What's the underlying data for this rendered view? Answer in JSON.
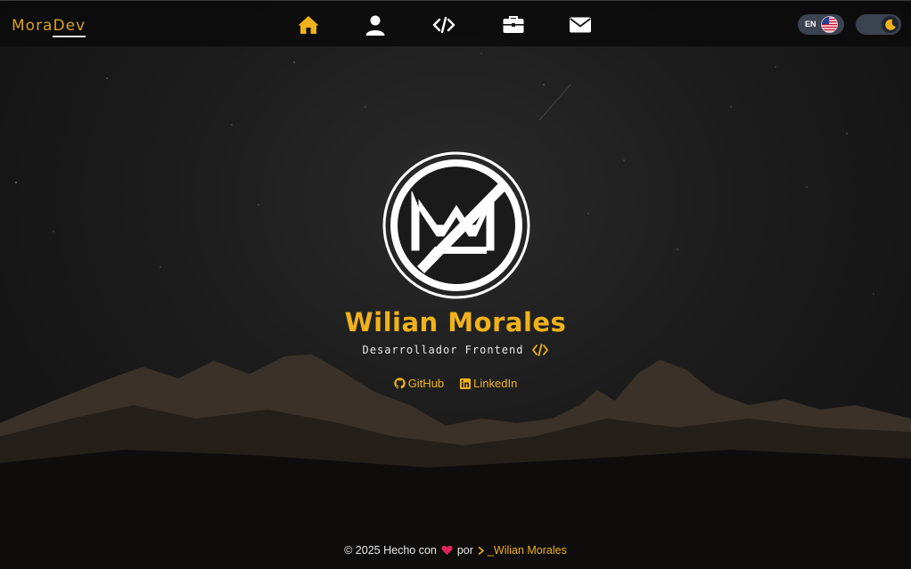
{
  "brand": {
    "part1": "Mora",
    "part2": "Dev"
  },
  "nav": {
    "items": [
      {
        "icon": "home-icon",
        "active": true
      },
      {
        "icon": "user-icon",
        "active": false
      },
      {
        "icon": "code-icon",
        "active": false
      },
      {
        "icon": "briefcase-icon",
        "active": false
      },
      {
        "icon": "envelope-icon",
        "active": false
      }
    ]
  },
  "language": {
    "label": "EN",
    "flag": "us-flag-icon"
  },
  "theme": {
    "mode": "dark",
    "icon": "moon-icon"
  },
  "hero": {
    "name": "Wilian Morales",
    "role": "Desarrollador Frontend",
    "links": [
      {
        "icon": "github-icon",
        "label": "GitHub"
      },
      {
        "icon": "linkedin-icon",
        "label": "LinkedIn"
      }
    ]
  },
  "footer": {
    "prefix": "© 2025 Hecho con",
    "connector": "por",
    "author": "_Wilian Morales"
  },
  "colors": {
    "accent": "#f0b21b",
    "heart": "#e0245e",
    "navbar_bg": "#0a0a0a",
    "toggle_bg": "#3b4250"
  }
}
